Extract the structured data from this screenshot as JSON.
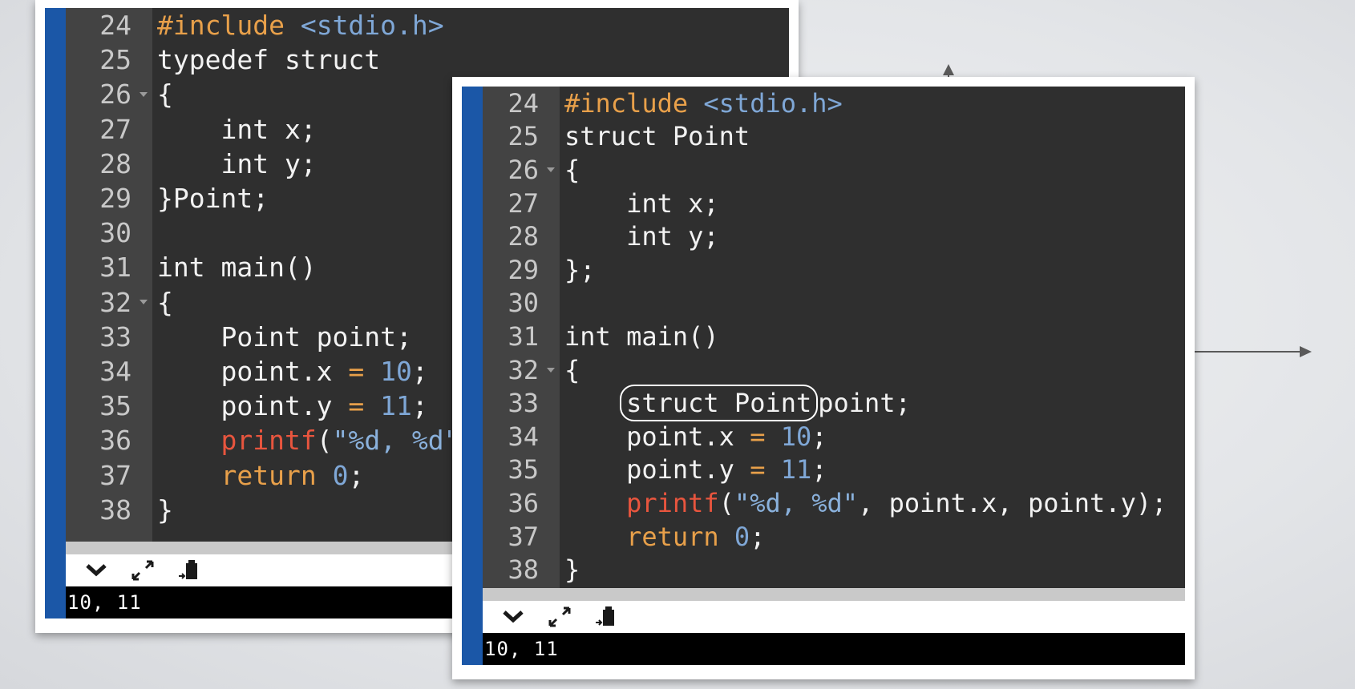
{
  "windows": [
    {
      "lines": [
        {
          "n": "24",
          "fold": false,
          "tokens": [
            {
              "t": "#include",
              "c": "pre"
            },
            {
              "t": " ",
              "c": ""
            },
            {
              "t": "<stdio.h>",
              "c": "hdr"
            }
          ]
        },
        {
          "n": "25",
          "fold": false,
          "tokens": [
            {
              "t": "typedef struct",
              "c": ""
            }
          ]
        },
        {
          "n": "26",
          "fold": true,
          "tokens": [
            {
              "t": "{",
              "c": ""
            }
          ]
        },
        {
          "n": "27",
          "fold": false,
          "tokens": [
            {
              "t": "    int x;",
              "c": ""
            }
          ]
        },
        {
          "n": "28",
          "fold": false,
          "tokens": [
            {
              "t": "    int y;",
              "c": ""
            }
          ]
        },
        {
          "n": "29",
          "fold": false,
          "tokens": [
            {
              "t": "}Point;",
              "c": ""
            }
          ]
        },
        {
          "n": "30",
          "fold": false,
          "tokens": []
        },
        {
          "n": "31",
          "fold": false,
          "tokens": [
            {
              "t": "int main()",
              "c": ""
            }
          ]
        },
        {
          "n": "32",
          "fold": true,
          "tokens": [
            {
              "t": "{",
              "c": ""
            }
          ]
        },
        {
          "n": "33",
          "fold": false,
          "tokens": [
            {
              "t": "    Point point;",
              "c": ""
            }
          ]
        },
        {
          "n": "34",
          "fold": false,
          "tokens": [
            {
              "t": "    point.x ",
              "c": ""
            },
            {
              "t": "=",
              "c": "op"
            },
            {
              "t": " ",
              "c": ""
            },
            {
              "t": "10",
              "c": "num"
            },
            {
              "t": ";",
              "c": ""
            }
          ]
        },
        {
          "n": "35",
          "fold": false,
          "tokens": [
            {
              "t": "    point.y ",
              "c": ""
            },
            {
              "t": "=",
              "c": "op"
            },
            {
              "t": " ",
              "c": ""
            },
            {
              "t": "11",
              "c": "num"
            },
            {
              "t": ";",
              "c": ""
            }
          ]
        },
        {
          "n": "36",
          "fold": false,
          "tokens": [
            {
              "t": "    ",
              "c": ""
            },
            {
              "t": "printf",
              "c": "fn"
            },
            {
              "t": "(",
              "c": ""
            },
            {
              "t": "\"%d, %d\"",
              "c": "str"
            }
          ]
        },
        {
          "n": "37",
          "fold": false,
          "tokens": [
            {
              "t": "    ",
              "c": ""
            },
            {
              "t": "return",
              "c": "kw"
            },
            {
              "t": " ",
              "c": ""
            },
            {
              "t": "0",
              "c": "num"
            },
            {
              "t": ";",
              "c": ""
            }
          ]
        },
        {
          "n": "38",
          "fold": false,
          "tokens": [
            {
              "t": "}",
              "c": ""
            }
          ]
        }
      ],
      "output": "10, 11"
    },
    {
      "lines": [
        {
          "n": "24",
          "fold": false,
          "tokens": [
            {
              "t": "#include",
              "c": "pre"
            },
            {
              "t": " ",
              "c": ""
            },
            {
              "t": "<stdio.h>",
              "c": "hdr"
            }
          ]
        },
        {
          "n": "25",
          "fold": false,
          "tokens": [
            {
              "t": "struct Point",
              "c": ""
            }
          ]
        },
        {
          "n": "26",
          "fold": true,
          "tokens": [
            {
              "t": "{",
              "c": ""
            }
          ]
        },
        {
          "n": "27",
          "fold": false,
          "tokens": [
            {
              "t": "    int x;",
              "c": ""
            }
          ]
        },
        {
          "n": "28",
          "fold": false,
          "tokens": [
            {
              "t": "    int y;",
              "c": ""
            }
          ]
        },
        {
          "n": "29",
          "fold": false,
          "tokens": [
            {
              "t": "};",
              "c": ""
            }
          ]
        },
        {
          "n": "30",
          "fold": false,
          "tokens": []
        },
        {
          "n": "31",
          "fold": false,
          "tokens": [
            {
              "t": "int main()",
              "c": ""
            }
          ]
        },
        {
          "n": "32",
          "fold": true,
          "tokens": [
            {
              "t": "{",
              "c": ""
            }
          ]
        },
        {
          "n": "33",
          "fold": false,
          "tokens": [
            {
              "t": "    ",
              "c": ""
            },
            {
              "t": "struct Point",
              "c": "box"
            },
            {
              "t": "point;",
              "c": ""
            }
          ]
        },
        {
          "n": "34",
          "fold": false,
          "tokens": [
            {
              "t": "    point.x ",
              "c": ""
            },
            {
              "t": "=",
              "c": "op"
            },
            {
              "t": " ",
              "c": ""
            },
            {
              "t": "10",
              "c": "num"
            },
            {
              "t": ";",
              "c": ""
            }
          ]
        },
        {
          "n": "35",
          "fold": false,
          "tokens": [
            {
              "t": "    point.y ",
              "c": ""
            },
            {
              "t": "=",
              "c": "op"
            },
            {
              "t": " ",
              "c": ""
            },
            {
              "t": "11",
              "c": "num"
            },
            {
              "t": ";",
              "c": ""
            }
          ]
        },
        {
          "n": "36",
          "fold": false,
          "tokens": [
            {
              "t": "    ",
              "c": ""
            },
            {
              "t": "printf",
              "c": "fn"
            },
            {
              "t": "(",
              "c": ""
            },
            {
              "t": "\"%d, %d\"",
              "c": "str"
            },
            {
              "t": ", point.x, point.y);",
              "c": ""
            }
          ]
        },
        {
          "n": "37",
          "fold": false,
          "tokens": [
            {
              "t": "    ",
              "c": ""
            },
            {
              "t": "return",
              "c": "kw"
            },
            {
              "t": " ",
              "c": ""
            },
            {
              "t": "0",
              "c": "num"
            },
            {
              "t": ";",
              "c": ""
            }
          ]
        },
        {
          "n": "38",
          "fold": false,
          "tokens": [
            {
              "t": "}",
              "c": ""
            }
          ]
        }
      ],
      "output": "10, 11"
    }
  ],
  "icons": [
    "chevron-down-icon",
    "expand-icon",
    "clipboard-icon"
  ],
  "colors": {
    "editor_bg": "#2f2f2f",
    "gutter_bg": "#434343",
    "accent_bar": "#1b57a7",
    "preprocessor": "#e8a04a",
    "header": "#7fa7d6",
    "number": "#7fa7d6",
    "function": "#e8553e",
    "string": "#8ab1dc",
    "keyword": "#e8a04a"
  }
}
